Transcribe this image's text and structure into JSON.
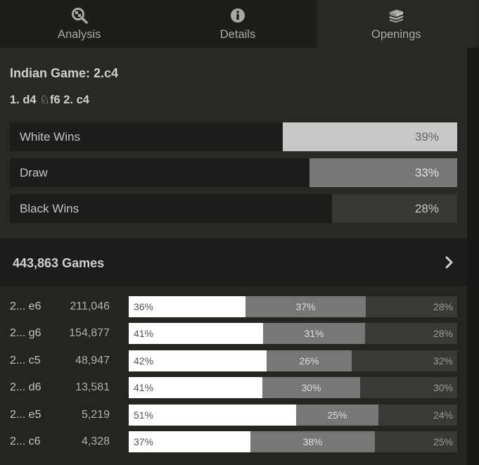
{
  "tabs": [
    {
      "label": "Analysis",
      "icon": "analysis-magnifier-icon",
      "active": false
    },
    {
      "label": "Details",
      "icon": "info-icon",
      "active": false
    },
    {
      "label": "Openings",
      "icon": "book-icon",
      "active": true
    }
  ],
  "opening": {
    "name": "Indian Game: 2.c4",
    "moves": "1. d4 ♘f6 2. c4"
  },
  "results": [
    {
      "label": "White Wins",
      "percent": "39%",
      "value": 39,
      "color": "#c8c8c8",
      "text_color": "#666666"
    },
    {
      "label": "Draw",
      "percent": "33%",
      "value": 33,
      "color": "#777777",
      "text_color": "#e2e2e2"
    },
    {
      "label": "Black Wins",
      "percent": "28%",
      "value": 28,
      "color": "#3a3835",
      "text_color": "#c8c8c8"
    }
  ],
  "games": {
    "count_label": "443,863 Games"
  },
  "moves": [
    {
      "move": "2... e6",
      "count": "211,046",
      "white": 36,
      "draw": 37,
      "black": 28,
      "white_label": "36%",
      "draw_label": "37%",
      "black_label": "28%"
    },
    {
      "move": "2... g6",
      "count": "154,877",
      "white": 41,
      "draw": 31,
      "black": 28,
      "white_label": "41%",
      "draw_label": "31%",
      "black_label": "28%"
    },
    {
      "move": "2... c5",
      "count": "48,947",
      "white": 42,
      "draw": 26,
      "black": 32,
      "white_label": "42%",
      "draw_label": "26%",
      "black_label": "32%"
    },
    {
      "move": "2... d6",
      "count": "13,581",
      "white": 41,
      "draw": 30,
      "black": 30,
      "white_label": "41%",
      "draw_label": "30%",
      "black_label": "30%"
    },
    {
      "move": "2... e5",
      "count": "5,219",
      "white": 51,
      "draw": 25,
      "black": 24,
      "white_label": "51%",
      "draw_label": "25%",
      "black_label": "24%"
    },
    {
      "move": "2... c6",
      "count": "4,328",
      "white": 37,
      "draw": 38,
      "black": 25,
      "white_label": "37%",
      "draw_label": "38%",
      "black_label": "25%"
    }
  ],
  "colors": {
    "background": "#262421",
    "panel": "#2a2825",
    "header": "#1e1c1a",
    "white_segment": "#ffffff",
    "draw_segment": "#777777",
    "black_segment": "#3b3936"
  }
}
